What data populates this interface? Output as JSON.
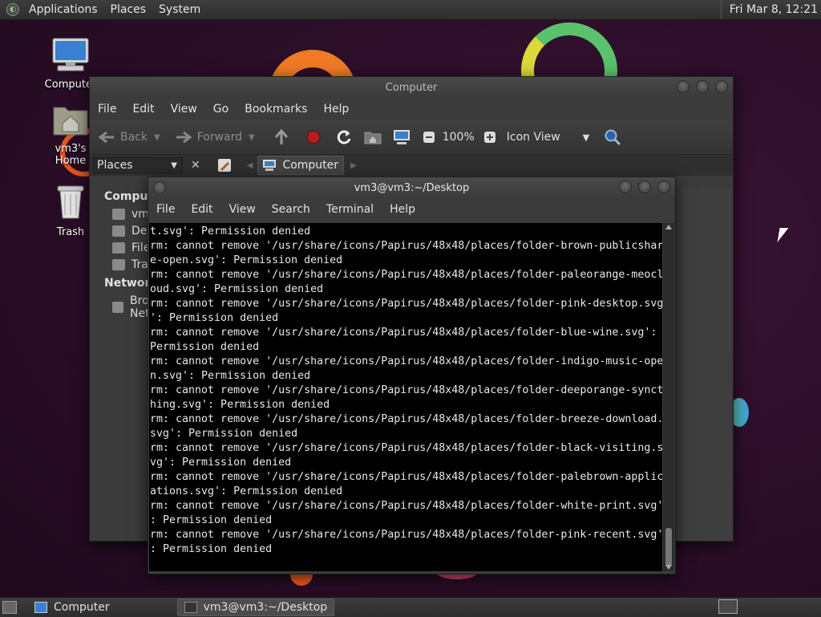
{
  "top_panel": {
    "menus": [
      "Applications",
      "Places",
      "System"
    ],
    "clock": "Fri Mar  8, 12:21"
  },
  "desktop": {
    "icons": [
      {
        "label": "Computer"
      },
      {
        "label": "vm3's Home"
      },
      {
        "label": "Trash"
      }
    ]
  },
  "file_manager": {
    "title": "Computer",
    "menus": [
      "File",
      "Edit",
      "View",
      "Go",
      "Bookmarks",
      "Help"
    ],
    "toolbar": {
      "back": "Back",
      "forward": "Forward",
      "zoom": "100%",
      "view_mode": "Icon View"
    },
    "side_pane_selector": "Places",
    "location_button": "Computer",
    "sidebar": {
      "header_computer": "Computer",
      "items": [
        "vm3",
        "Desktop",
        "File System",
        "Trash"
      ],
      "header_network": "Network",
      "network_items": [
        "Browse Network"
      ]
    }
  },
  "terminal": {
    "title": "vm3@vm3:~/Desktop",
    "menus": [
      "File",
      "Edit",
      "View",
      "Search",
      "Terminal",
      "Help"
    ],
    "lines": [
      "t.svg': Permission denied",
      "rm: cannot remove '/usr/share/icons/Papirus/48x48/places/folder-brown-publicshar",
      "e-open.svg': Permission denied",
      "rm: cannot remove '/usr/share/icons/Papirus/48x48/places/folder-paleorange-meocl",
      "oud.svg': Permission denied",
      "rm: cannot remove '/usr/share/icons/Papirus/48x48/places/folder-pink-desktop.svg",
      "': Permission denied",
      "rm: cannot remove '/usr/share/icons/Papirus/48x48/places/folder-blue-wine.svg':",
      "Permission denied",
      "rm: cannot remove '/usr/share/icons/Papirus/48x48/places/folder-indigo-music-ope",
      "n.svg': Permission denied",
      "rm: cannot remove '/usr/share/icons/Papirus/48x48/places/folder-deeporange-synct",
      "hing.svg': Permission denied",
      "rm: cannot remove '/usr/share/icons/Papirus/48x48/places/folder-breeze-download.",
      "svg': Permission denied",
      "rm: cannot remove '/usr/share/icons/Papirus/48x48/places/folder-black-visiting.s",
      "vg': Permission denied",
      "rm: cannot remove '/usr/share/icons/Papirus/48x48/places/folder-palebrown-applic",
      "ations.svg': Permission denied",
      "rm: cannot remove '/usr/share/icons/Papirus/48x48/places/folder-white-print.svg'",
      ": Permission denied",
      "rm: cannot remove '/usr/share/icons/Papirus/48x48/places/folder-pink-recent.svg'",
      ": Permission denied"
    ]
  },
  "taskbar": {
    "tasks": [
      "Computer",
      "vm3@vm3:~/Desktop"
    ]
  }
}
